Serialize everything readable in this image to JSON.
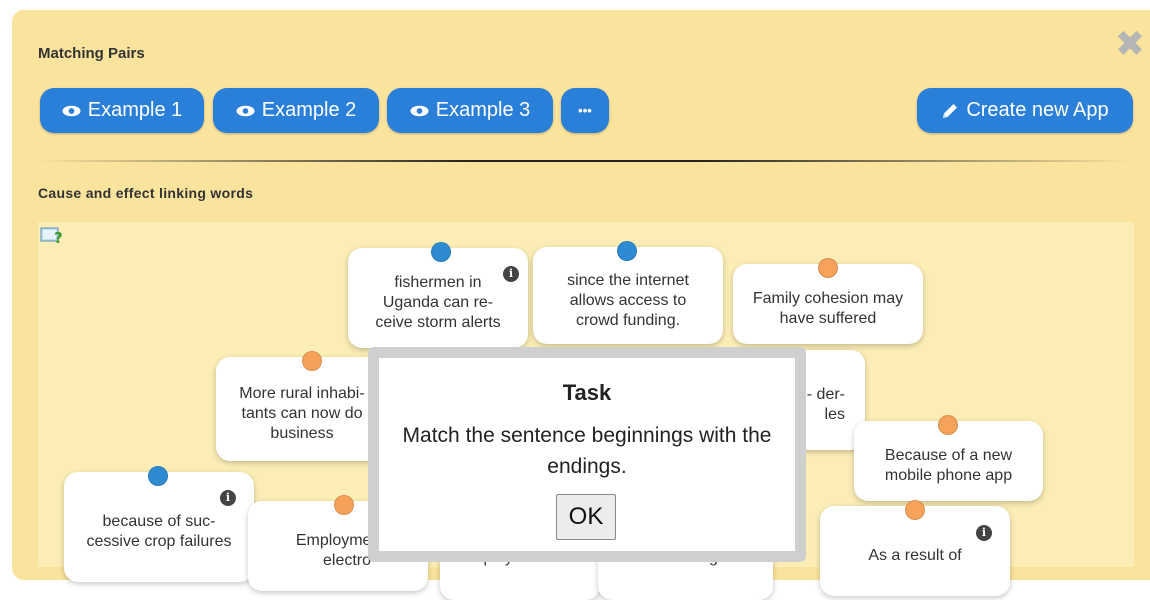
{
  "app": {
    "title": "Matching Pairs",
    "close_icon": "close-icon",
    "buttons": [
      {
        "label": "Example 1",
        "icon": "eye-icon"
      },
      {
        "label": "Example 2",
        "icon": "eye-icon"
      },
      {
        "label": "Example 3",
        "icon": "eye-icon"
      },
      {
        "label": "•••",
        "icon": "more-icon"
      }
    ],
    "create_button": {
      "label": "Create new App",
      "icon": "pencil-icon"
    },
    "section_title": "Cause and effect linking words",
    "help_icon": "help-icon"
  },
  "cards": [
    {
      "text": "fishermen in Uganda can re-ceive storm alerts",
      "pin": "blue",
      "info": true
    },
    {
      "text": "since the internet allows access to crowd funding.",
      "pin": "blue",
      "info": false
    },
    {
      "text": "Family cohesion may have suffered",
      "pin": "orange",
      "info": false
    },
    {
      "text": "More rural inhabi-tants can now do business",
      "pin": "orange",
      "info": false
    },
    {
      "text": "stal- der- les",
      "pin": "none",
      "info": false
    },
    {
      "text": "Because of a new mobile phone app",
      "pin": "orange",
      "info": false
    },
    {
      "text": "because of suc-cessive crop failures",
      "pin": "blue",
      "info": true
    },
    {
      "text": "Employme the electro",
      "pin": "orange",
      "info": false
    },
    {
      "text": "employees of in-",
      "pin": "none",
      "info": false
    },
    {
      "text": "forced to migrate",
      "pin": "none",
      "info": false
    },
    {
      "text": "As a result of",
      "pin": "orange",
      "info": true
    }
  ],
  "colors": {
    "pin_blue": "#2f8bd1",
    "pin_orange": "#f6a25a",
    "button": "#2a7fd8",
    "panel": "#fae39c"
  },
  "modal": {
    "title": "Task",
    "text": "Match the sentence beginnings with the endings.",
    "ok": "OK"
  }
}
